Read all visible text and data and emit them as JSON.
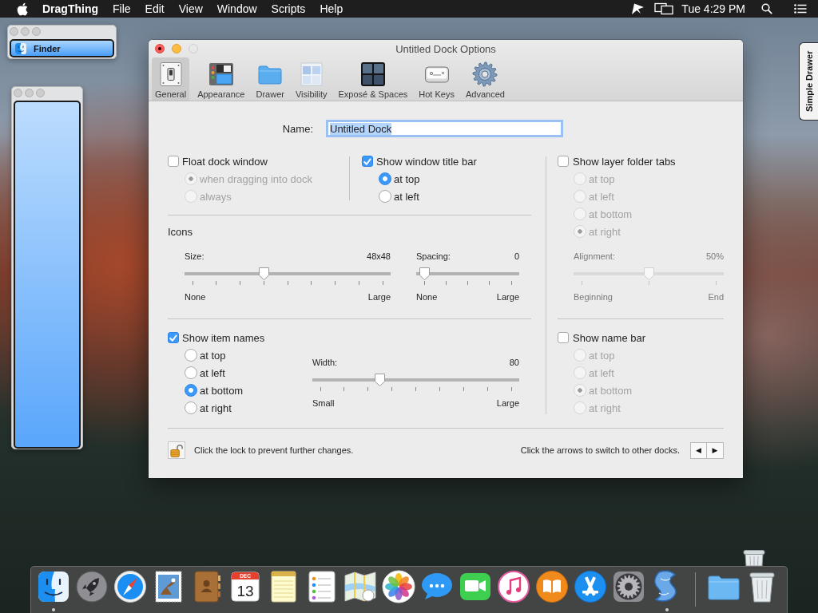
{
  "menu_bar": {
    "app_name": "DragThing",
    "menus": [
      "File",
      "Edit",
      "View",
      "Window",
      "Scripts",
      "Help"
    ],
    "clock": "Tue 4:29 PM"
  },
  "dock_window": {
    "items": [
      {
        "label": "Finder",
        "selected": true
      }
    ]
  },
  "dialog": {
    "title": "Untitled Dock Options",
    "tabs": [
      {
        "kind": "switch",
        "label": "General",
        "selected": true
      },
      {
        "kind": "layout",
        "label": "Appearance",
        "selected": false
      },
      {
        "kind": "folder",
        "label": "Drawer",
        "selected": false
      },
      {
        "kind": "panes",
        "label": "Visibility",
        "selected": false
      },
      {
        "kind": "grid",
        "label": "Exposé & Spaces",
        "selected": false
      },
      {
        "kind": "key",
        "label": "Hot Keys",
        "selected": false
      },
      {
        "kind": "gear",
        "label": "Advanced",
        "selected": false
      }
    ],
    "name_field": {
      "label": "Name:",
      "value": "Untitled Dock"
    },
    "float_window": {
      "label": "Float dock window",
      "checked": false,
      "options_disabled": true,
      "options": [
        {
          "label": "when dragging into dock",
          "selected": true
        },
        {
          "label": "always",
          "selected": false
        }
      ]
    },
    "title_bar": {
      "label": "Show window title bar",
      "checked": true,
      "options_disabled": false,
      "options": [
        {
          "label": "at top",
          "selected": true
        },
        {
          "label": "at left",
          "selected": false
        }
      ]
    },
    "layer_tabs": {
      "label": "Show layer folder tabs",
      "checked": false,
      "options_disabled": true,
      "options": [
        {
          "label": "at top",
          "selected": false
        },
        {
          "label": "at left",
          "selected": false
        },
        {
          "label": "at bottom",
          "selected": false
        },
        {
          "label": "at right",
          "selected": true
        }
      ]
    },
    "icons": {
      "heading": "Icons",
      "sliders": [
        {
          "label": "Size:",
          "reading": "48x48",
          "level": 0.375,
          "min_label": "None",
          "max_label": "Large",
          "disabled": false
        },
        {
          "label": "Spacing:",
          "reading": "0",
          "level": 0,
          "min_label": "None",
          "max_label": "Large",
          "disabled": false
        }
      ]
    },
    "alignment": {
      "label": "Alignment:",
      "reading": "50%",
      "level": 0.5,
      "min_label": "Beginning",
      "max_label": "End",
      "disabled": true
    },
    "item_names": {
      "label": "Show item names",
      "checked": true,
      "options_disabled": false,
      "options": [
        {
          "label": "at top",
          "selected": false
        },
        {
          "label": "at left",
          "selected": false
        },
        {
          "label": "at bottom",
          "selected": true
        },
        {
          "label": "at right",
          "selected": false
        }
      ],
      "width_slider": {
        "label": "Width:",
        "reading": "80",
        "level": 0.31,
        "min_label": "Small",
        "max_label": "Large",
        "disabled": false
      }
    },
    "name_bar": {
      "label": "Show name bar",
      "checked": false,
      "options_disabled": true,
      "options": [
        {
          "label": "at top",
          "selected": false
        },
        {
          "label": "at left",
          "selected": false
        },
        {
          "label": "at bottom",
          "selected": true
        },
        {
          "label": "at right",
          "selected": false
        }
      ]
    },
    "footer": {
      "lock_text": "Click the lock to prevent further changes.",
      "arrows_text": "Click the arrows to switch to other docks.",
      "arrows": [
        "◀",
        "▶"
      ]
    }
  },
  "drawer_tab": {
    "label": "Simple Drawer"
  },
  "dock": {
    "apps": [
      {
        "kind": "face",
        "running": true
      },
      {
        "kind": "rocket",
        "running": false
      },
      {
        "kind": "compass",
        "running": false
      },
      {
        "kind": "stamp",
        "running": false
      },
      {
        "kind": "contacts",
        "running": false
      },
      {
        "kind": "calendar",
        "month": "DEC",
        "day": "13",
        "running": false
      },
      {
        "kind": "notepad",
        "running": false
      },
      {
        "kind": "checklist",
        "running": false
      },
      {
        "kind": "map",
        "running": false
      },
      {
        "kind": "flower",
        "running": false
      },
      {
        "kind": "chat",
        "running": false
      },
      {
        "kind": "video",
        "running": false
      },
      {
        "kind": "music",
        "running": false
      },
      {
        "kind": "book",
        "running": false
      },
      {
        "kind": "tools",
        "running": false
      },
      {
        "kind": "gear",
        "running": false
      },
      {
        "kind": "ribbon",
        "running": true
      }
    ],
    "stacks": [
      {
        "kind": "folder"
      },
      {
        "kind": "trash"
      }
    ]
  }
}
